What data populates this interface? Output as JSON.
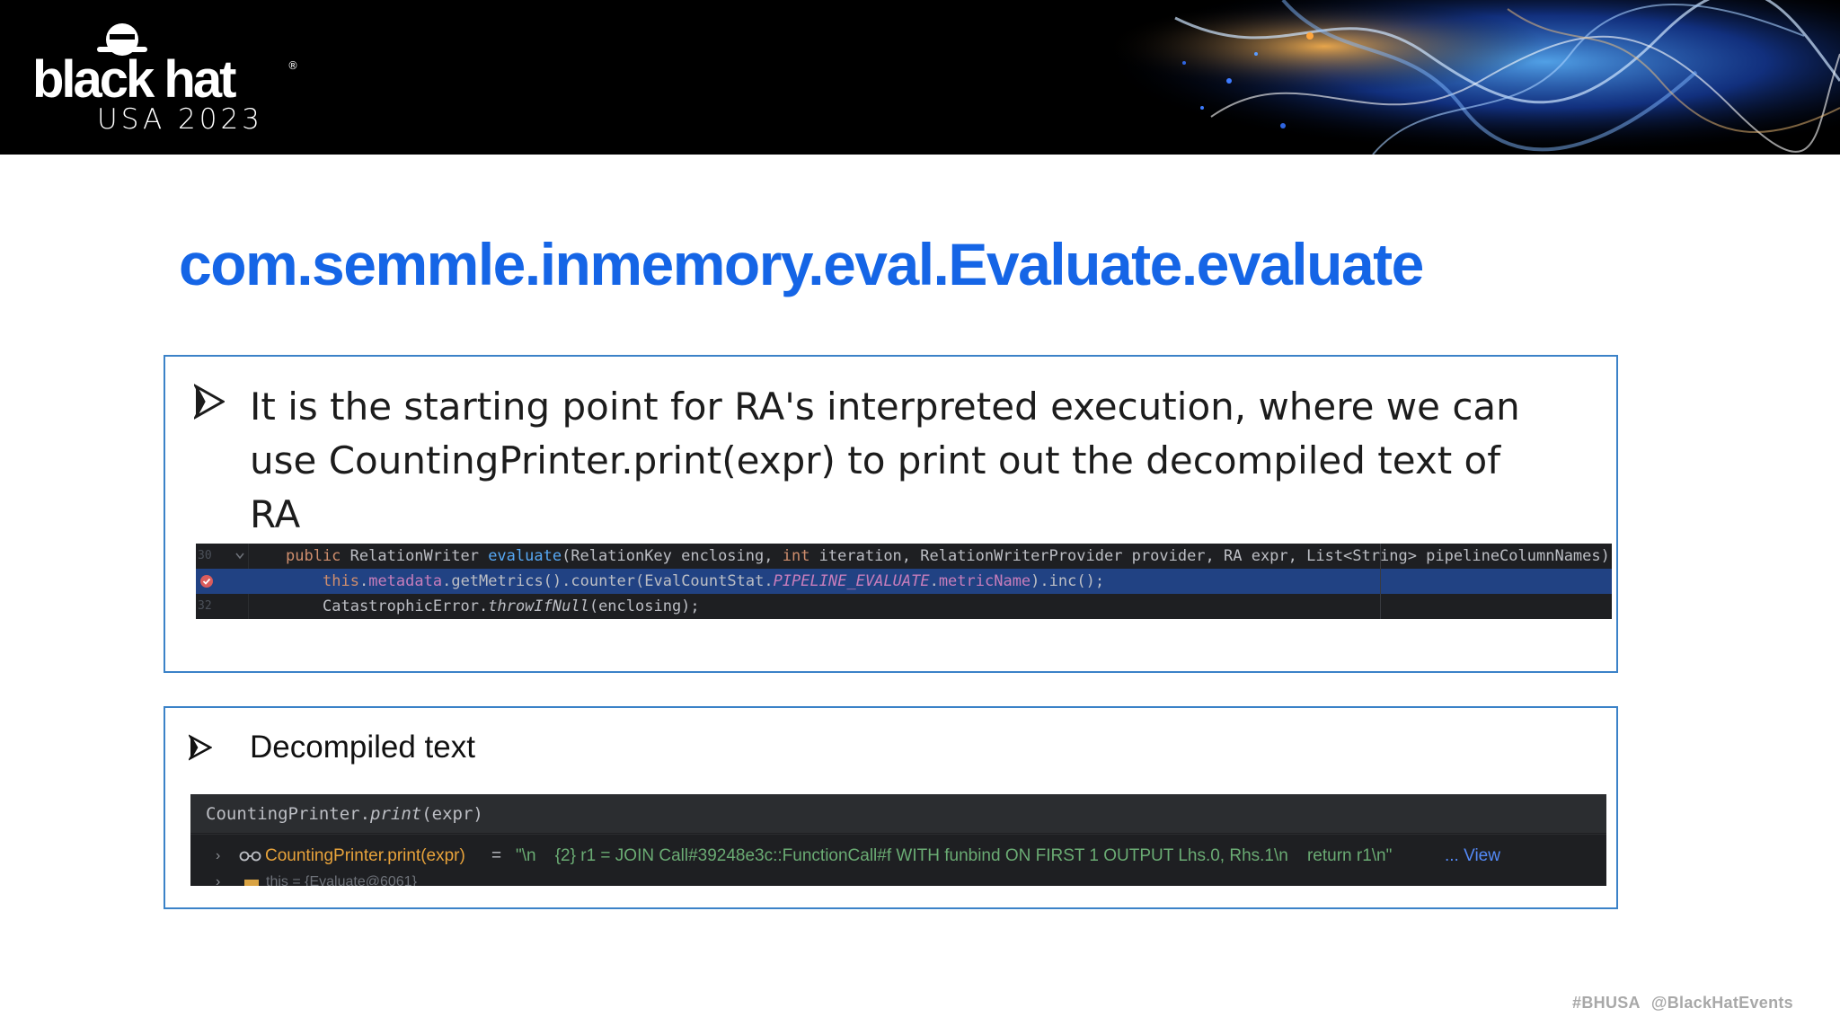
{
  "header": {
    "logo_word": "black hat",
    "logo_reg": "®",
    "logo_sub": "USA 2023"
  },
  "slide": {
    "title": "com.semmle.inmemory.eval.Evaluate.evaluate",
    "bullet1": "It is the starting point for RA's interpreted execution, where we can use CountingPrinter.print(expr) to print out the decompiled text of RA",
    "bullet2": "Decompiled text"
  },
  "code1": {
    "lines": [
      {
        "number": "30",
        "parts": [
          {
            "t": "public ",
            "c": "kw"
          },
          {
            "t": "RelationWriter ",
            "c": ""
          },
          {
            "t": "evaluate",
            "c": "fn"
          },
          {
            "t": "(RelationKey enclosing, ",
            "c": ""
          },
          {
            "t": "int ",
            "c": "kw"
          },
          {
            "t": "iteration, RelationWriterProvider provider, RA expr, List<String> pipelineColumnNames)",
            "c": ""
          }
        ]
      },
      {
        "number": "",
        "parts": [
          {
            "t": "this",
            "c": "kw"
          },
          {
            "t": ".",
            "c": ""
          },
          {
            "t": "metadata",
            "c": "fld"
          },
          {
            "t": ".getMetrics().counter(EvalCountStat.",
            "c": ""
          },
          {
            "t": "PIPELINE_EVALUATE",
            "c": "st"
          },
          {
            "t": ".",
            "c": ""
          },
          {
            "t": "metricName",
            "c": "fld"
          },
          {
            "t": ").inc();",
            "c": ""
          }
        ]
      },
      {
        "number": "32",
        "parts": [
          {
            "t": "CatastrophicError.",
            "c": ""
          },
          {
            "t": "throwIfNull",
            "c": "it"
          },
          {
            "t": "(enclosing);",
            "c": ""
          }
        ]
      }
    ]
  },
  "code2": {
    "header_plain": "CountingPrinter.",
    "header_italic": "print",
    "header_rest": "(expr)",
    "var_name": "CountingPrinter.print(expr)",
    "var_eq": "=",
    "var_value": "\"\\n    {2} r1 = JOIN Call#39248e3c::FunctionCall#f WITH funbind ON FIRST 1 OUTPUT Lhs.0, Rhs.1\\n    return r1\\n\"",
    "var_view": "... View",
    "row2_text": "this = {Evaluate@6061}"
  },
  "footer": {
    "hashtag": "#BHUSA",
    "handle": "@BlackHatEvents"
  },
  "colors": {
    "title": "#1565e6",
    "box_border": "#3b82c8",
    "highlight": "#214283"
  }
}
